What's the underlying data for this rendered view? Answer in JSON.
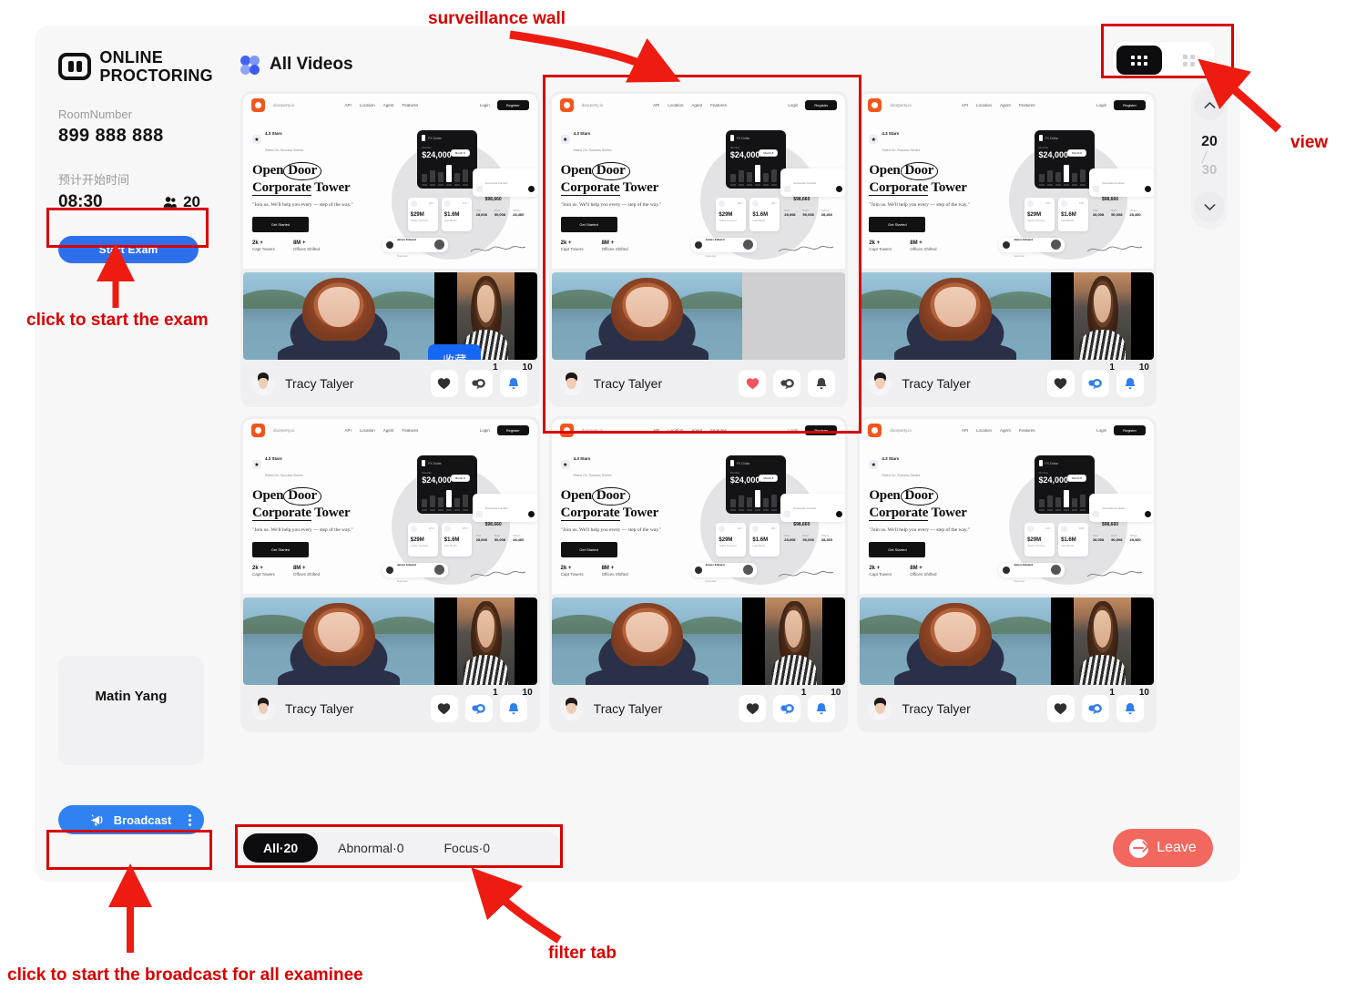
{
  "sidebar": {
    "logo": {
      "line1": "Online",
      "line2": "Proctoring",
      "icon": "proctoring-logo-icon"
    },
    "room_label": "RoomNumber",
    "room_number": "899 888 888",
    "start_time_label": "预计开始时间",
    "start_time": "08:30",
    "participants_count": "20",
    "participants_icon": "people-icon",
    "start_exam_label": "Start Exam",
    "self_name": "Matin Yang",
    "broadcast_label": "Broadcast",
    "broadcast_icon": "megaphone-icon",
    "broadcast_menu_icon": "kebab-menu-icon"
  },
  "header": {
    "title": "All Videos",
    "title_icon": "four-dots-flower-icon",
    "view_toggle": {
      "grid_six_icon": "grid-six-icon",
      "grid_four_icon": "grid-four-icon",
      "active": "grid-six-icon"
    }
  },
  "pager": {
    "current": "20",
    "total": "30",
    "up_icon": "chevron-up-icon",
    "down_icon": "chevron-down-icon"
  },
  "tooltip": {
    "text": "收藏"
  },
  "cards": [
    {
      "name": "Tracy Talyer",
      "heart_active": false,
      "chat_active": false,
      "bell_active": true,
      "chat_badge": "1",
      "bell_badge": "10",
      "side_cam_blank": false,
      "tooltip": true,
      "highlighted": false
    },
    {
      "name": "Tracy Talyer",
      "heart_active": true,
      "chat_active": false,
      "bell_active": false,
      "chat_badge": "",
      "bell_badge": "",
      "side_cam_blank": true,
      "tooltip": false,
      "highlighted": true
    },
    {
      "name": "Tracy Talyer",
      "heart_active": false,
      "chat_active": true,
      "bell_active": true,
      "chat_badge": "1",
      "bell_badge": "10",
      "side_cam_blank": false,
      "tooltip": false,
      "highlighted": false
    },
    {
      "name": "Tracy Talyer",
      "heart_active": false,
      "chat_active": true,
      "bell_active": true,
      "chat_badge": "1",
      "bell_badge": "10",
      "side_cam_blank": false,
      "tooltip": false,
      "highlighted": false
    },
    {
      "name": "Tracy Talyer",
      "heart_active": false,
      "chat_active": true,
      "bell_active": true,
      "chat_badge": "1",
      "bell_badge": "10",
      "side_cam_blank": false,
      "tooltip": false,
      "highlighted": false
    },
    {
      "name": "Tracy Talyer",
      "heart_active": false,
      "chat_active": true,
      "bell_active": true,
      "chat_badge": "1",
      "bell_badge": "10",
      "side_cam_blank": false,
      "tooltip": false,
      "highlighted": false
    }
  ],
  "shared_screen": {
    "brand": "doorperty.io",
    "nav": [
      "API",
      "Location",
      "Agent",
      "Features"
    ],
    "login": "Login",
    "register": "Register",
    "rating": "4.3 Stars",
    "rating_sub": "Rated On: Success Stories",
    "headline_1": "Open",
    "headline_circle": "Door",
    "headline_2": "Corporate Tower",
    "quote": "\"Join us. We'll help you every — step of the way.\"",
    "cta": "Get Started",
    "stats": [
      {
        "number": "2k +",
        "caption": "Capt Towers"
      },
      {
        "number": "8M +",
        "caption": "Offices Shifted"
      }
    ],
    "panel_sub": "Monthly",
    "panel_amount": "$24,000",
    "panel_pill": "Month 8",
    "white_card": {
      "label": "Successful Contract",
      "amount": "$98,660",
      "cols": [
        {
          "k": "Paid",
          "v": "28,008"
        },
        {
          "k": "Build",
          "v": "50,008"
        },
        {
          "k": "Others",
          "v": "28,460"
        }
      ]
    },
    "mini_cards": [
      {
        "value": "$29M",
        "caption": "Yearly Turnover"
      },
      {
        "value": "$1.6M",
        "caption": "Last Month"
      }
    ],
    "person": {
      "name": "James Edward",
      "role": "Supervisor"
    }
  },
  "filters": {
    "tabs": [
      {
        "label": "All·20",
        "active": true
      },
      {
        "label": "Abnormal·0",
        "active": false
      },
      {
        "label": "Focus·0",
        "active": false
      }
    ]
  },
  "leave": {
    "label": "Leave",
    "icon": "leave-icon",
    "color": "#f2685f"
  },
  "annotations": [
    {
      "id": "surveillance-wall",
      "text": "surveillance wall"
    },
    {
      "id": "view",
      "text": "view"
    },
    {
      "id": "start-exam",
      "text": "click to start the exam"
    },
    {
      "id": "broadcast",
      "text": "click to start the broadcast for all examinee"
    },
    {
      "id": "filter-tab",
      "text": "filter tab"
    }
  ]
}
